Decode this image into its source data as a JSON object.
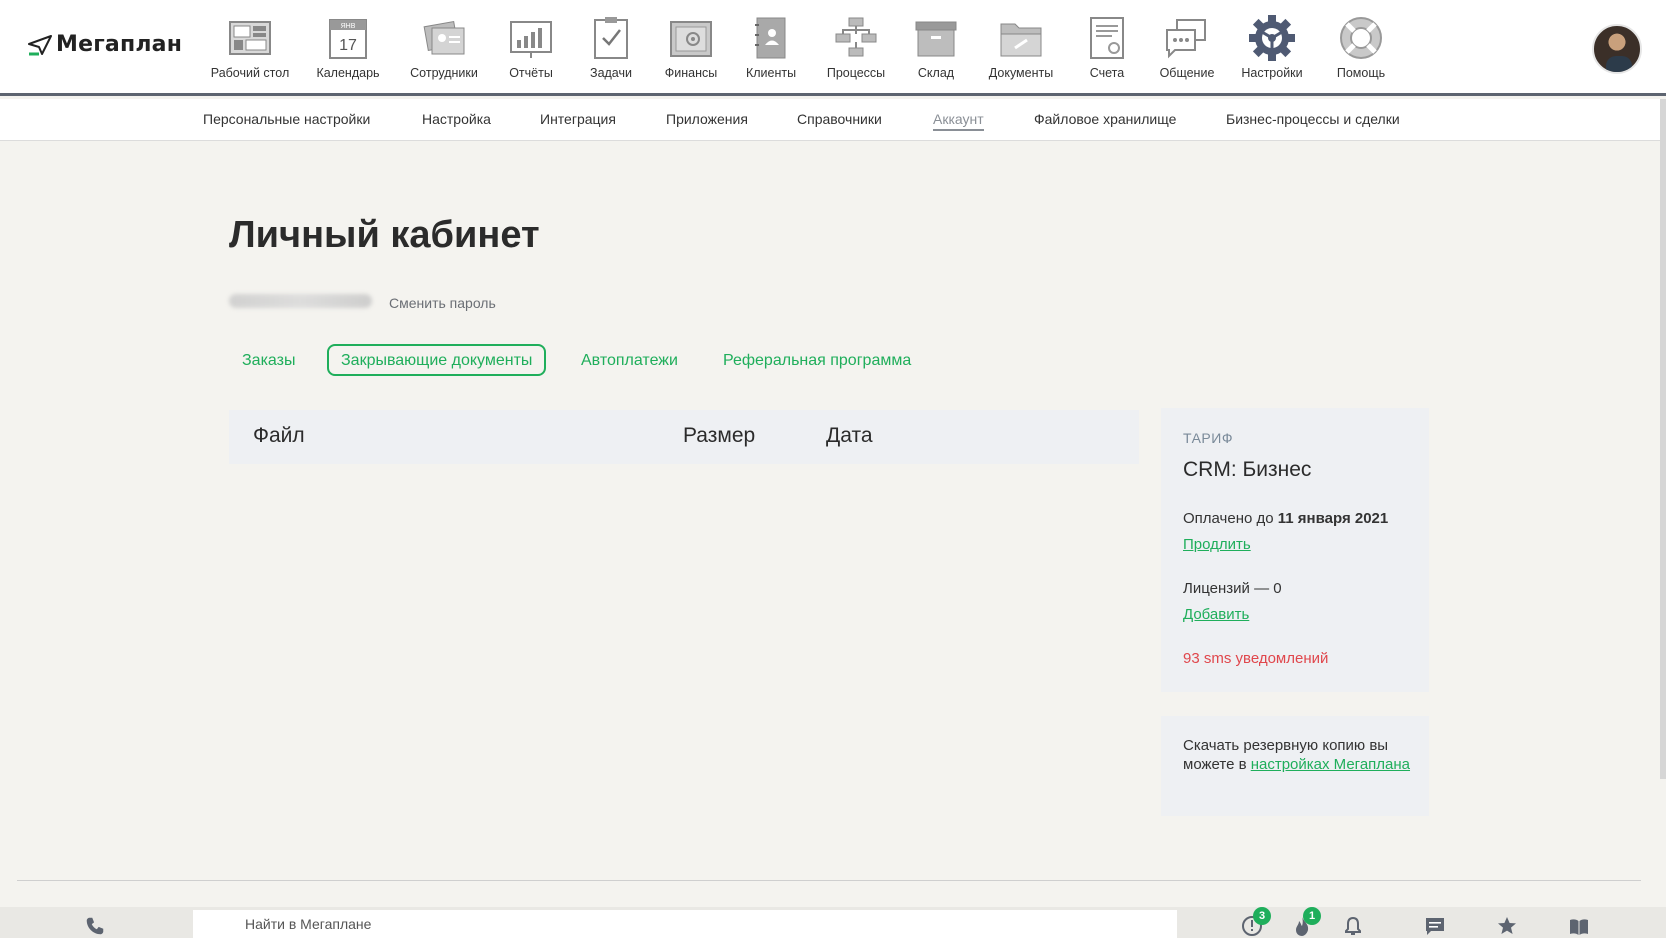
{
  "app": {
    "logo_text": "Мегаплан"
  },
  "nav": {
    "items": [
      {
        "label": "Рабочий стол",
        "icon": "desktop-icon"
      },
      {
        "label": "Календарь",
        "icon": "calendar-icon",
        "day": "17",
        "month": "ЯНВ"
      },
      {
        "label": "Сотрудники",
        "icon": "employees-icon"
      },
      {
        "label": "Отчёты",
        "icon": "reports-icon"
      },
      {
        "label": "Задачи",
        "icon": "tasks-icon"
      },
      {
        "label": "Финансы",
        "icon": "finance-safe-icon"
      },
      {
        "label": "Клиенты",
        "icon": "clients-icon"
      },
      {
        "label": "Процессы",
        "icon": "processes-icon"
      },
      {
        "label": "Склад",
        "icon": "warehouse-box-icon"
      },
      {
        "label": "Документы",
        "icon": "documents-folder-icon"
      },
      {
        "label": "Счета",
        "icon": "invoices-icon"
      },
      {
        "label": "Общение",
        "icon": "chat-icon"
      },
      {
        "label": "Настройки",
        "icon": "settings-gear-icon",
        "active": true
      },
      {
        "label": "Помощь",
        "icon": "help-lifebuoy-icon"
      }
    ]
  },
  "subnav": {
    "items": [
      {
        "label": "Персональные настройки"
      },
      {
        "label": "Настройка"
      },
      {
        "label": "Интеграция"
      },
      {
        "label": "Приложения"
      },
      {
        "label": "Справочники"
      },
      {
        "label": "Аккаунт",
        "active": true
      },
      {
        "label": "Файловое хранилище"
      },
      {
        "label": "Бизнес-процессы и сделки"
      }
    ]
  },
  "main": {
    "title": "Личный кабинет",
    "change_password": "Сменить пароль",
    "tabs": [
      {
        "label": "Заказы"
      },
      {
        "label": "Закрывающие документы",
        "active": true
      },
      {
        "label": "Автоплатежи"
      },
      {
        "label": "Реферальная программа"
      }
    ],
    "table": {
      "columns": [
        "Файл",
        "Размер",
        "Дата"
      ],
      "rows": []
    }
  },
  "tariff": {
    "label": "ТАРИФ",
    "plan": "CRM: Бизнес",
    "paid_prefix": "Оплачено до",
    "paid_until": "11 января 2021",
    "extend_link": "Продлить",
    "licenses_text": "Лицензий — 0",
    "add_link": "Добавить",
    "sms_text": "93 sms уведомлений"
  },
  "backup": {
    "text": "Скачать резервную копию вы можете в",
    "link": "настройках Мегаплана"
  },
  "bottombar": {
    "search_placeholder": "Найти в Мегаплане",
    "alerts_badge": "3",
    "fire_badge": "1"
  },
  "colors": {
    "accent": "#1fae5b",
    "danger": "#e0474c",
    "header_border": "#5d6470"
  }
}
